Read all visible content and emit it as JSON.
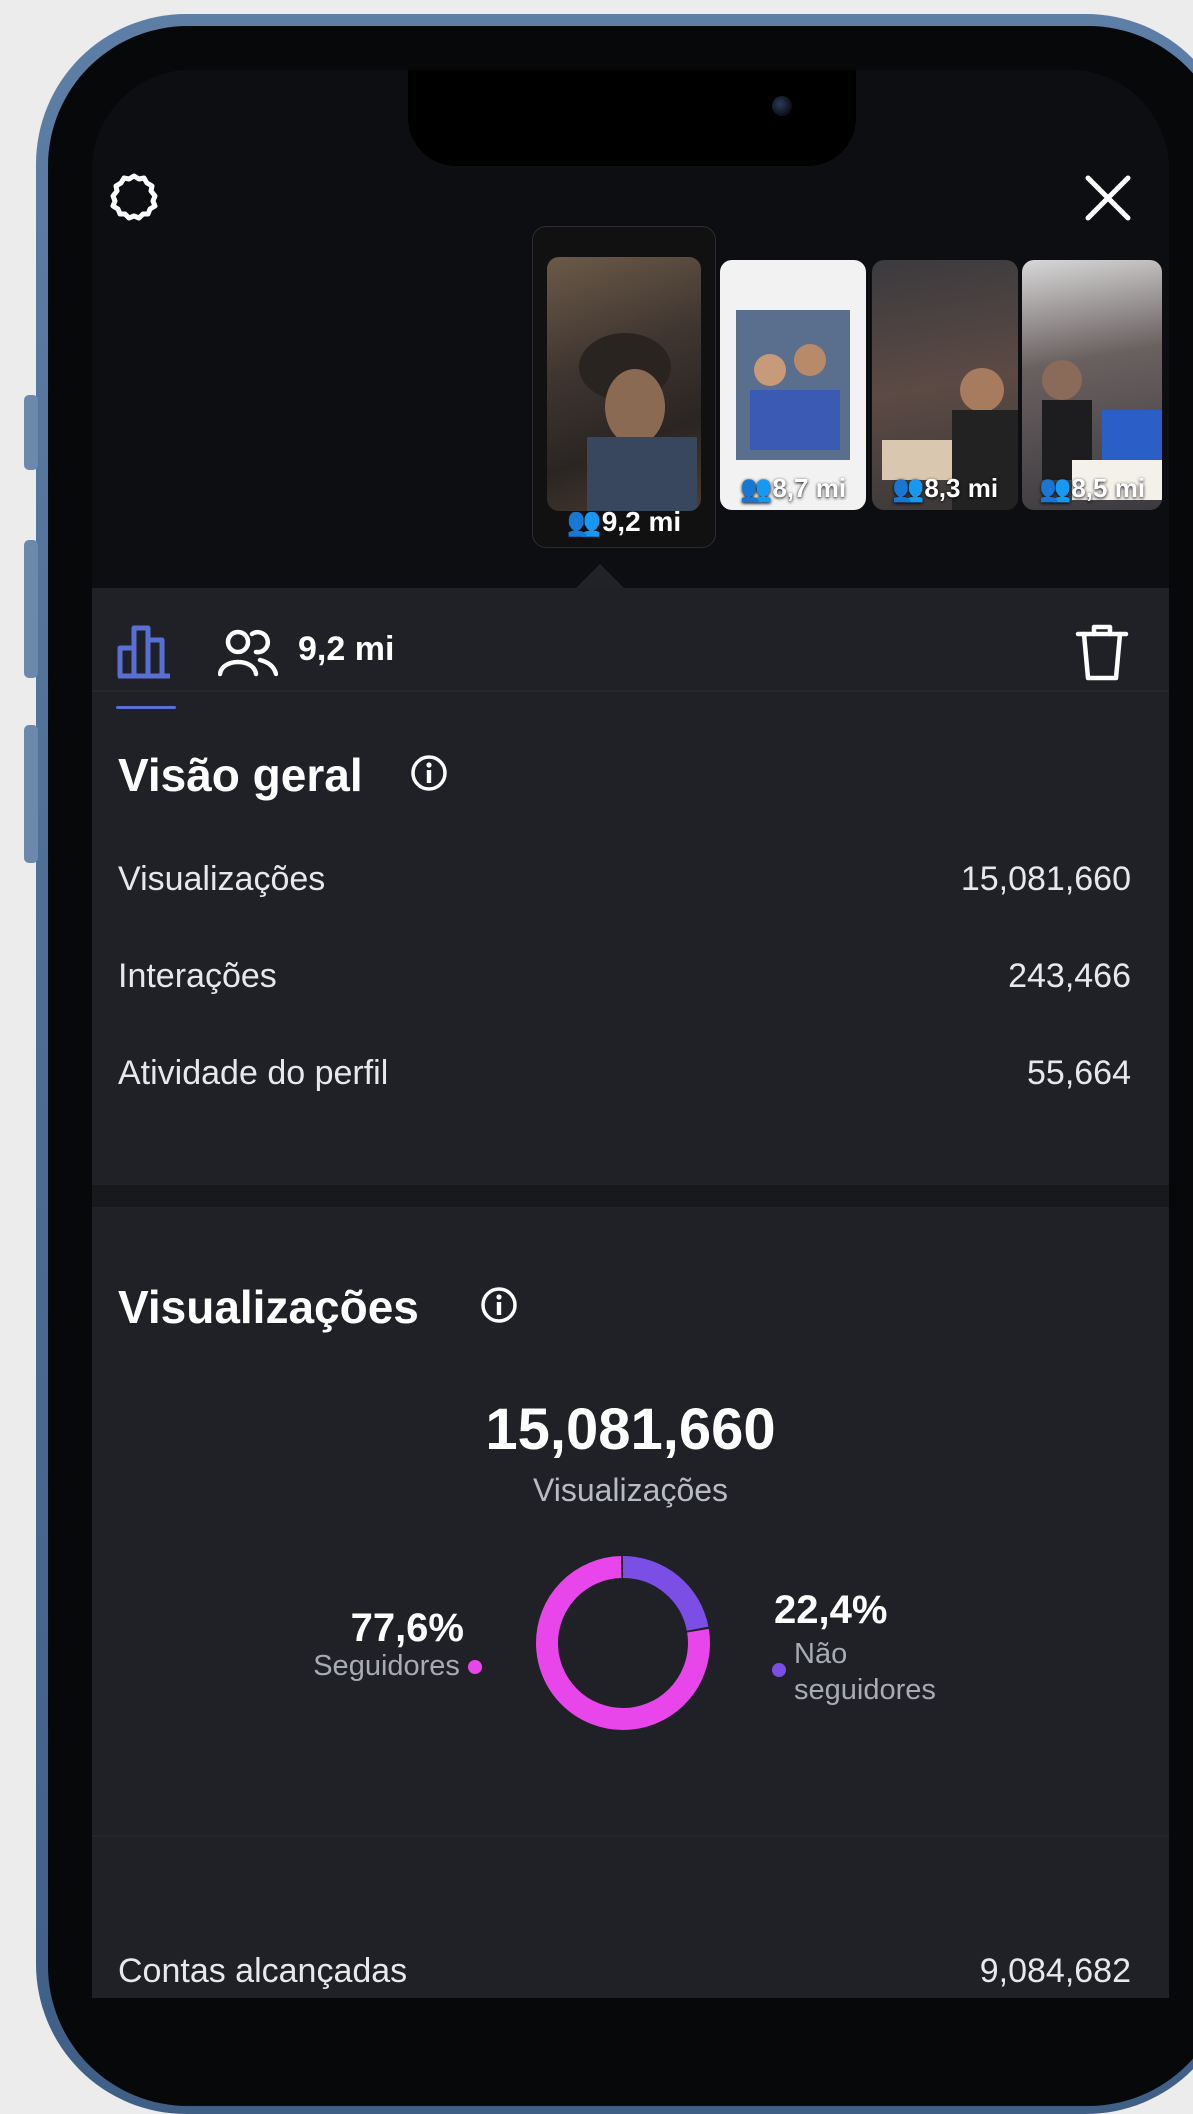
{
  "stories": [
    {
      "count": "9,2 mi",
      "selected": true
    },
    {
      "count": "8,7 mi",
      "selected": false
    },
    {
      "count": "8,3 mi",
      "selected": false
    },
    {
      "count": "8,5 mi",
      "selected": false
    }
  ],
  "toolbar": {
    "reach_count": "9,2 mi"
  },
  "overview": {
    "title": "Visão geral",
    "rows": [
      {
        "label": "Visualizações",
        "value": "15,081,660"
      },
      {
        "label": "Interações",
        "value": "243,466"
      },
      {
        "label": "Atividade do perfil",
        "value": "55,664"
      }
    ]
  },
  "views": {
    "title": "Visualizações",
    "total": "15,081,660",
    "total_label": "Visualizações",
    "followers_pct": "77,6%",
    "followers_label": "Seguidores",
    "non_followers_pct": "22,4%",
    "non_followers_label_1": "Não",
    "non_followers_label_2": "seguidores"
  },
  "chart_data": {
    "type": "pie",
    "categories": [
      "Seguidores",
      "Não seguidores"
    ],
    "values": [
      77.6,
      22.4
    ],
    "colors": [
      "#e846ea",
      "#7b4fe6"
    ]
  },
  "accounts": {
    "label": "Contas alcançadas",
    "value": "9,084,682"
  },
  "colors": {
    "accent": "#5a6fd6",
    "followers": "#e846ea",
    "non_followers": "#7b4fe6",
    "panel": "#1f2126"
  }
}
